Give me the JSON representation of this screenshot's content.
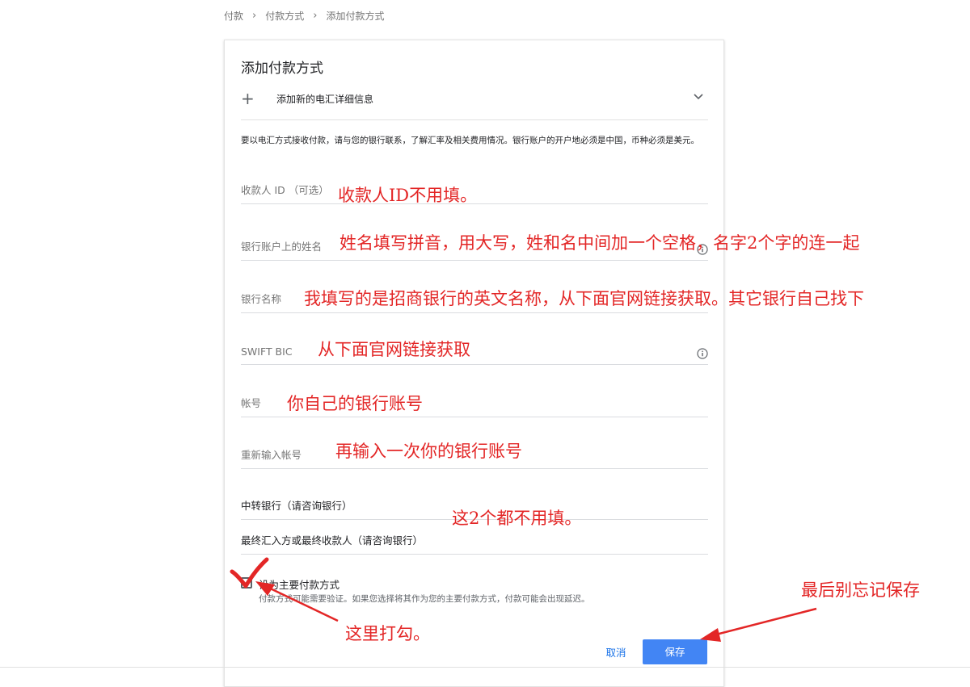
{
  "breadcrumb": [
    "付款",
    "付款方式",
    "添加付款方式"
  ],
  "card": {
    "title": "添加付款方式",
    "add_wire_label": "添加新的电汇详细信息",
    "notice": "要以电汇方式接收付款，请与您的银行联系，了解汇率及相关费用情况。银行账户的开户地必须是中国，币种必须是美元。"
  },
  "fields": {
    "payee_id": "收款人 ID （可选）",
    "account_name": "银行账户上的姓名",
    "bank_name": "银行名称",
    "swift": "SWIFT BIC",
    "account_number": "帐号",
    "account_number_confirm": "重新输入帐号",
    "intermediary_bank": "中转银行（请咨询银行）",
    "final_beneficiary": "最终汇入方或最终收款人（请咨询银行）"
  },
  "checkbox": {
    "label": "设为主要付款方式",
    "help": "付款方式可能需要验证。如果您选择将其作为您的主要付款方式，付款可能会出现延迟。",
    "checked": false
  },
  "buttons": {
    "cancel": "取消",
    "save": "保存"
  },
  "annotations": {
    "payee_id": "收款人ID不用填。",
    "account_name": "姓名填写拼音，用大写，姓和名中间加一个空格，名字2个字的连一起",
    "bank_name": "我填写的是招商银行的英文名称，从下面官网链接获取。其它银行自己找下",
    "swift": "从下面官网链接获取",
    "account_number": "你自己的银行账号",
    "account_number_confirm": "再输入一次你的银行账号",
    "optional_fields": "这2个都不用填。",
    "checkbox": "这里打勾。",
    "save": "最后别忘记保存"
  },
  "colors": {
    "annotation": "#e32626",
    "primary": "#4285f4",
    "link": "#1a73e8"
  },
  "icons": {
    "plus": "plus-icon",
    "chevron": "chevron-down-icon",
    "info": "info-icon"
  }
}
